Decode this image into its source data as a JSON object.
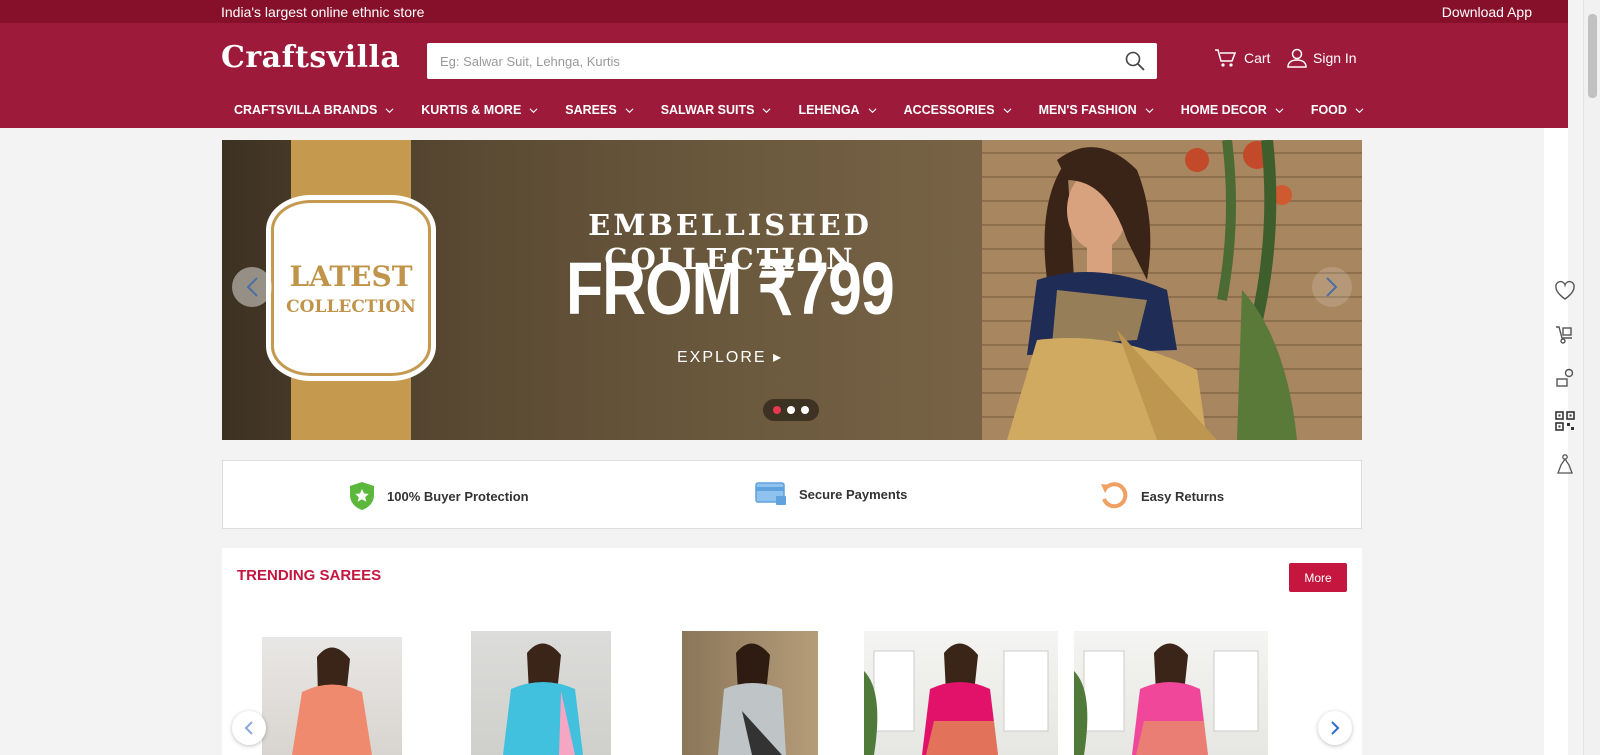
{
  "topbar": {
    "tagline": "India's largest online ethnic store",
    "download_app": "Download App"
  },
  "header": {
    "logo": "Craftsvilla",
    "search_placeholder": "Eg: Salwar Suit, Lehnga, Kurtis",
    "cart_label": "Cart",
    "signin_label": "Sign In"
  },
  "nav": [
    {
      "label": "CRAFTSVILLA BRANDS"
    },
    {
      "label": "KURTIS & MORE"
    },
    {
      "label": "SAREES"
    },
    {
      "label": "SALWAR SUITS"
    },
    {
      "label": "LEHENGA"
    },
    {
      "label": "ACCESSORIES"
    },
    {
      "label": "MEN'S FASHION"
    },
    {
      "label": "HOME DECOR"
    },
    {
      "label": "FOOD"
    }
  ],
  "banner": {
    "badge_line1": "LATEST",
    "badge_line2": "COLLECTION",
    "headline": "EMBELLISHED COLLECTION",
    "price": "FROM ₹799",
    "cta": "EXPLORE ▸",
    "active_slide": 1,
    "slide_count": 3
  },
  "features": [
    {
      "label": "100% Buyer Protection",
      "icon": "shield-icon"
    },
    {
      "label": "Secure Payments",
      "icon": "card-icon"
    },
    {
      "label": "Easy Returns",
      "icon": "return-icon"
    }
  ],
  "trending": {
    "title": "TRENDING SAREES",
    "more_label": "More"
  },
  "colors": {
    "brand": "#9d1a3a",
    "topbar": "#861029",
    "accent": "#c4163f"
  }
}
